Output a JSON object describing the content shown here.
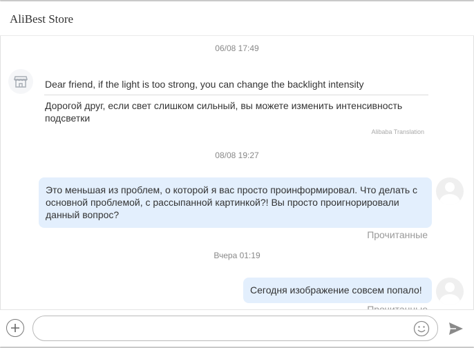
{
  "header": {
    "store_name": "AliBest Store"
  },
  "messages": [
    {
      "type": "timestamp",
      "text": "06/08 17:49"
    },
    {
      "type": "incoming",
      "original": "Dear friend, if the light is too strong, you can change the backlight intensity",
      "translation": "Дорогой друг, если свет слишком сильный, вы можете изменить интенсивность подсветки",
      "translation_credit": "Alibaba Translation"
    },
    {
      "type": "timestamp",
      "text": "08/08 19:27"
    },
    {
      "type": "outgoing",
      "text": "Это меньшая из проблем, о которой я вас просто проинформировал. Что делать с основной проблемой, с рассыпанной картинкой?! Вы просто проигнорировали данный вопрос?",
      "status": "Прочитанные"
    },
    {
      "type": "timestamp",
      "text": "Вчера 01:19"
    },
    {
      "type": "outgoing",
      "text": "Сегодня изображение совсем попало!",
      "status": "Прочитанные"
    }
  ],
  "composer": {
    "value": "",
    "placeholder": ""
  },
  "icons": {
    "shop": "store-icon",
    "user": "user-avatar-icon",
    "attach": "plus-icon",
    "emoji": "smiley-icon",
    "send": "send-icon"
  },
  "colors": {
    "outgoing_bubble": "#e3effd",
    "timestamp": "#888888",
    "status": "#999999"
  }
}
